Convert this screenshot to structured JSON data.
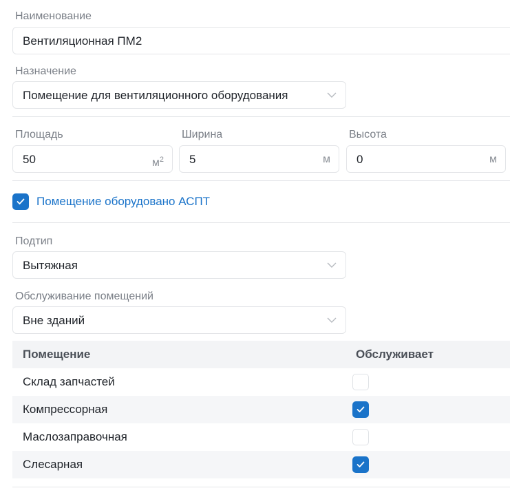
{
  "name": {
    "label": "Наименование",
    "value": "Вентиляционная ПМ2"
  },
  "purpose": {
    "label": "Назначение",
    "value": "Помещение для вентиляционного оборудования"
  },
  "dimensions": {
    "area": {
      "label": "Площадь",
      "value": "50",
      "unit": "м",
      "unit_sup": "2"
    },
    "width": {
      "label": "Ширина",
      "value": "5",
      "unit": "м"
    },
    "height": {
      "label": "Высота",
      "value": "0",
      "unit": "м"
    }
  },
  "aspt": {
    "label": "Помещение оборудовано АСПТ",
    "checked": true
  },
  "subtype": {
    "label": "Подтип",
    "value": "Вытяжная"
  },
  "service": {
    "label": "Обслуживание помещений",
    "value": "Вне зданий"
  },
  "rooms_table": {
    "headers": [
      "Помещение",
      "Обслуживает"
    ],
    "rows": [
      {
        "name": "Склад запчастей",
        "serves": false
      },
      {
        "name": "Компрессорная",
        "serves": true
      },
      {
        "name": "Маслозаправочная",
        "serves": false
      },
      {
        "name": "Слесарная",
        "serves": true
      }
    ]
  },
  "colors": {
    "accent": "#1a73c9",
    "label": "#7a7f87",
    "border": "#e3e5e8",
    "row_alt": "#f5f6f8"
  }
}
